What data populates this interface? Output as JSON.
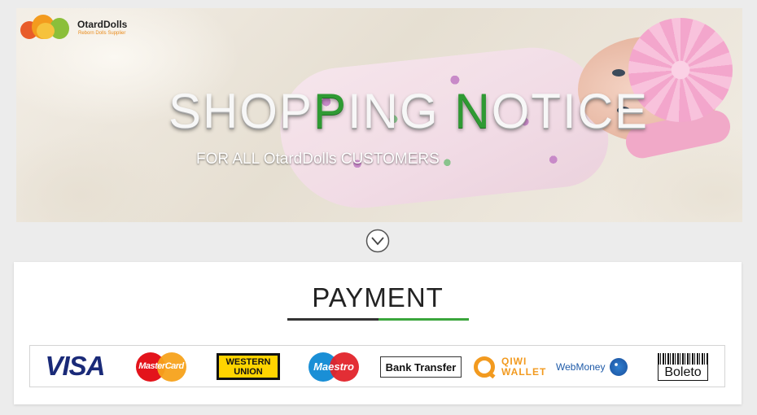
{
  "brand": {
    "name": "OtardDolls",
    "tagline": "Reborn Dolls Supplier"
  },
  "banner": {
    "headline_parts": [
      "SHOP",
      "P",
      "ING ",
      "N",
      "OTICE"
    ],
    "subheadline": "FOR ALL OtardDolls CUSTOMERS"
  },
  "scroll_hint": {
    "icon": "chevron-down-circle-icon"
  },
  "payment": {
    "title": "PAYMENT",
    "methods": [
      {
        "name": "visa",
        "label": "VISA"
      },
      {
        "name": "mastercard",
        "label": "MasterCard"
      },
      {
        "name": "western-union",
        "label_line1": "WESTERN",
        "label_line2": "UNION"
      },
      {
        "name": "maestro",
        "label": "Maestro"
      },
      {
        "name": "bank-transfer",
        "label": "Bank Transfer"
      },
      {
        "name": "qiwi-wallet",
        "label_line1": "QIWI",
        "label_line2": "WALLET"
      },
      {
        "name": "webmoney",
        "label": "WebMoney"
      },
      {
        "name": "boleto",
        "label": "Boleto"
      }
    ]
  },
  "colors": {
    "accent_green": "#3aa53c",
    "page_background": "#ececec",
    "visa_blue": "#1a2a78",
    "qiwi_orange": "#f29a1f"
  }
}
